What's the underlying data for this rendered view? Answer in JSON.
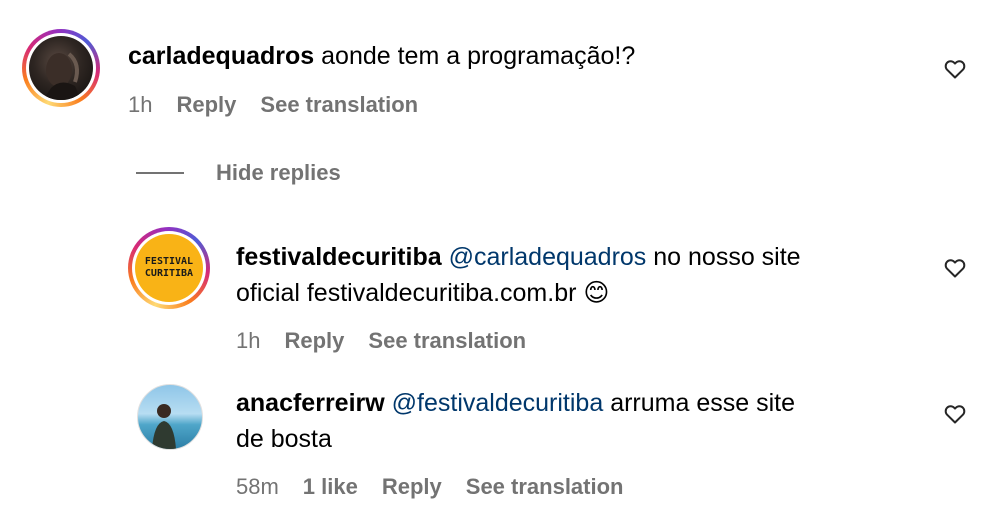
{
  "comments": [
    {
      "username": "carladequadros",
      "text": "aonde tem a programação!?",
      "time": "1h",
      "reply_label": "Reply",
      "translate_label": "See translation"
    }
  ],
  "hide_replies_label": "Hide replies",
  "replies": [
    {
      "username": "festivaldecuritiba",
      "logo_text_line1": "FESTIVAL",
      "logo_text_line2": "CURITIBA",
      "mention": "@carladequadros",
      "text_line1": "no nosso site",
      "text_line2": "oficial festivaldecuritiba.com.br",
      "emoji": "😊",
      "time": "1h",
      "reply_label": "Reply",
      "translate_label": "See translation"
    },
    {
      "username": "anacferreirw",
      "mention": "@festivaldecuritiba",
      "text_line1": "arruma esse site",
      "text_line2": "de bosta",
      "time": "58m",
      "likes": "1 like",
      "reply_label": "Reply",
      "translate_label": "See translation"
    }
  ],
  "icons": {
    "like": "heart-outline-icon"
  },
  "colors": {
    "meta": "#737373",
    "mention": "#00376b",
    "logo_bg": "#f9b316"
  }
}
